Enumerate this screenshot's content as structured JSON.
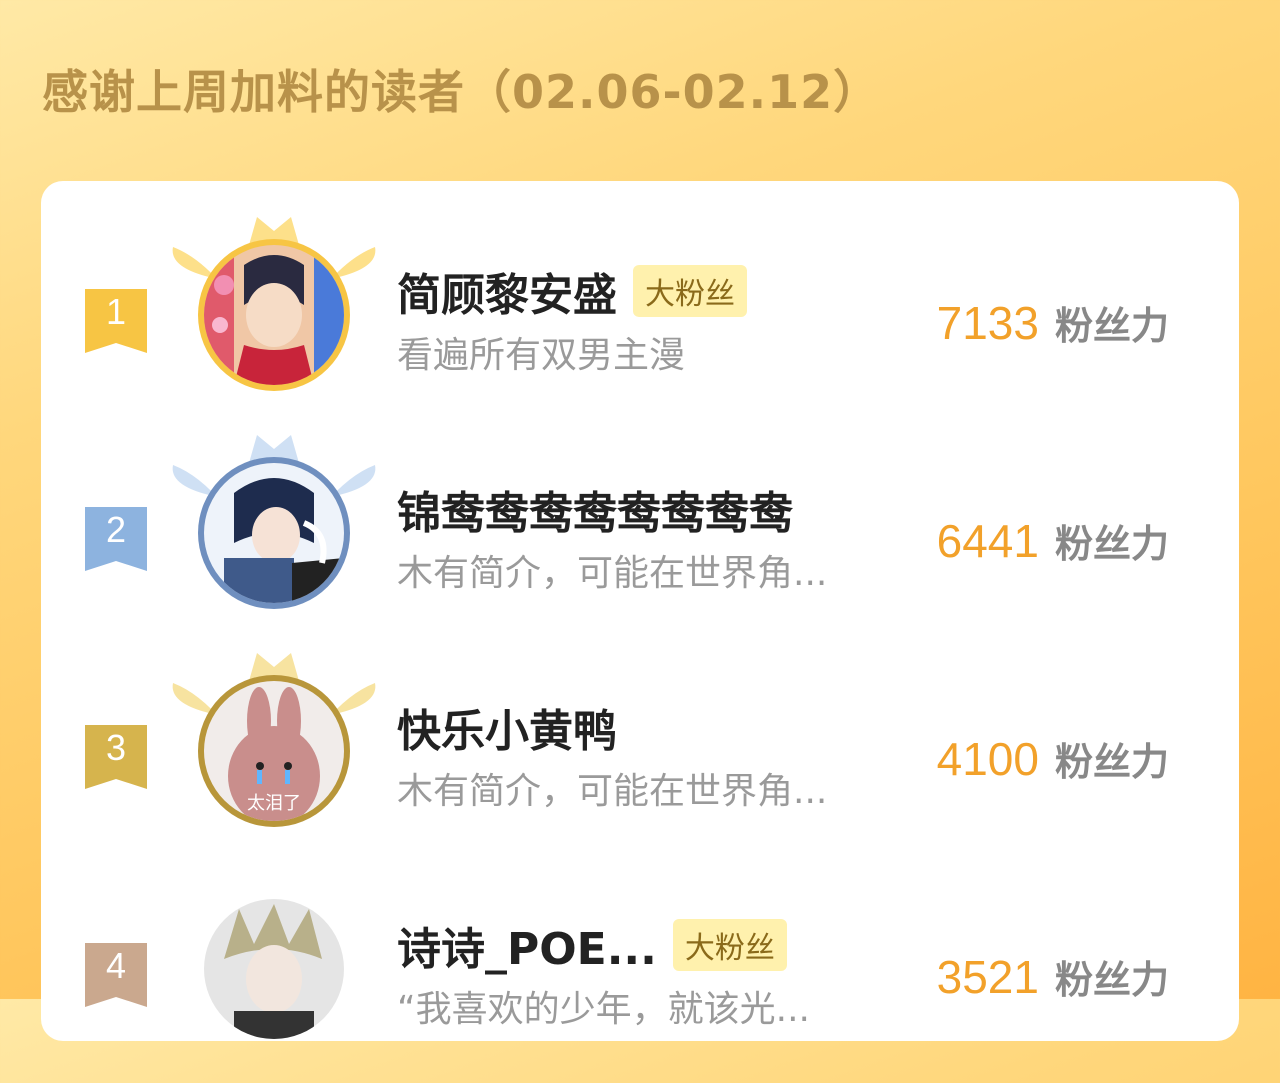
{
  "header": {
    "title": "感谢上周加料的读者（02.06-02.12）"
  },
  "colors": {
    "gold": "#f7c544",
    "silver": "#8db3df",
    "bronze": "#d6b44d",
    "fourth": "#caa88e",
    "score": "#f2a12a"
  },
  "readers": [
    {
      "rank": "1",
      "name": "简顾黎安盛",
      "badge": "大粉丝",
      "bio": "看遍所有双男主漫",
      "score": "7133",
      "unit": "粉丝力"
    },
    {
      "rank": "2",
      "name": "锦鸯鸯鸯鸯鸯鸯鸯鸯",
      "badge": "",
      "bio": "木有简介，可能在世界角...",
      "score": "6441",
      "unit": "粉丝力"
    },
    {
      "rank": "3",
      "name": "快乐小黄鸭",
      "badge": "",
      "bio": "木有简介，可能在世界角...",
      "score": "4100",
      "unit": "粉丝力",
      "avatar_caption": "太泪了"
    },
    {
      "rank": "4",
      "name": "诗诗_POE...",
      "badge": "大粉丝",
      "bio": "“我喜欢的少年，就该光...",
      "score": "3521",
      "unit": "粉丝力"
    }
  ]
}
